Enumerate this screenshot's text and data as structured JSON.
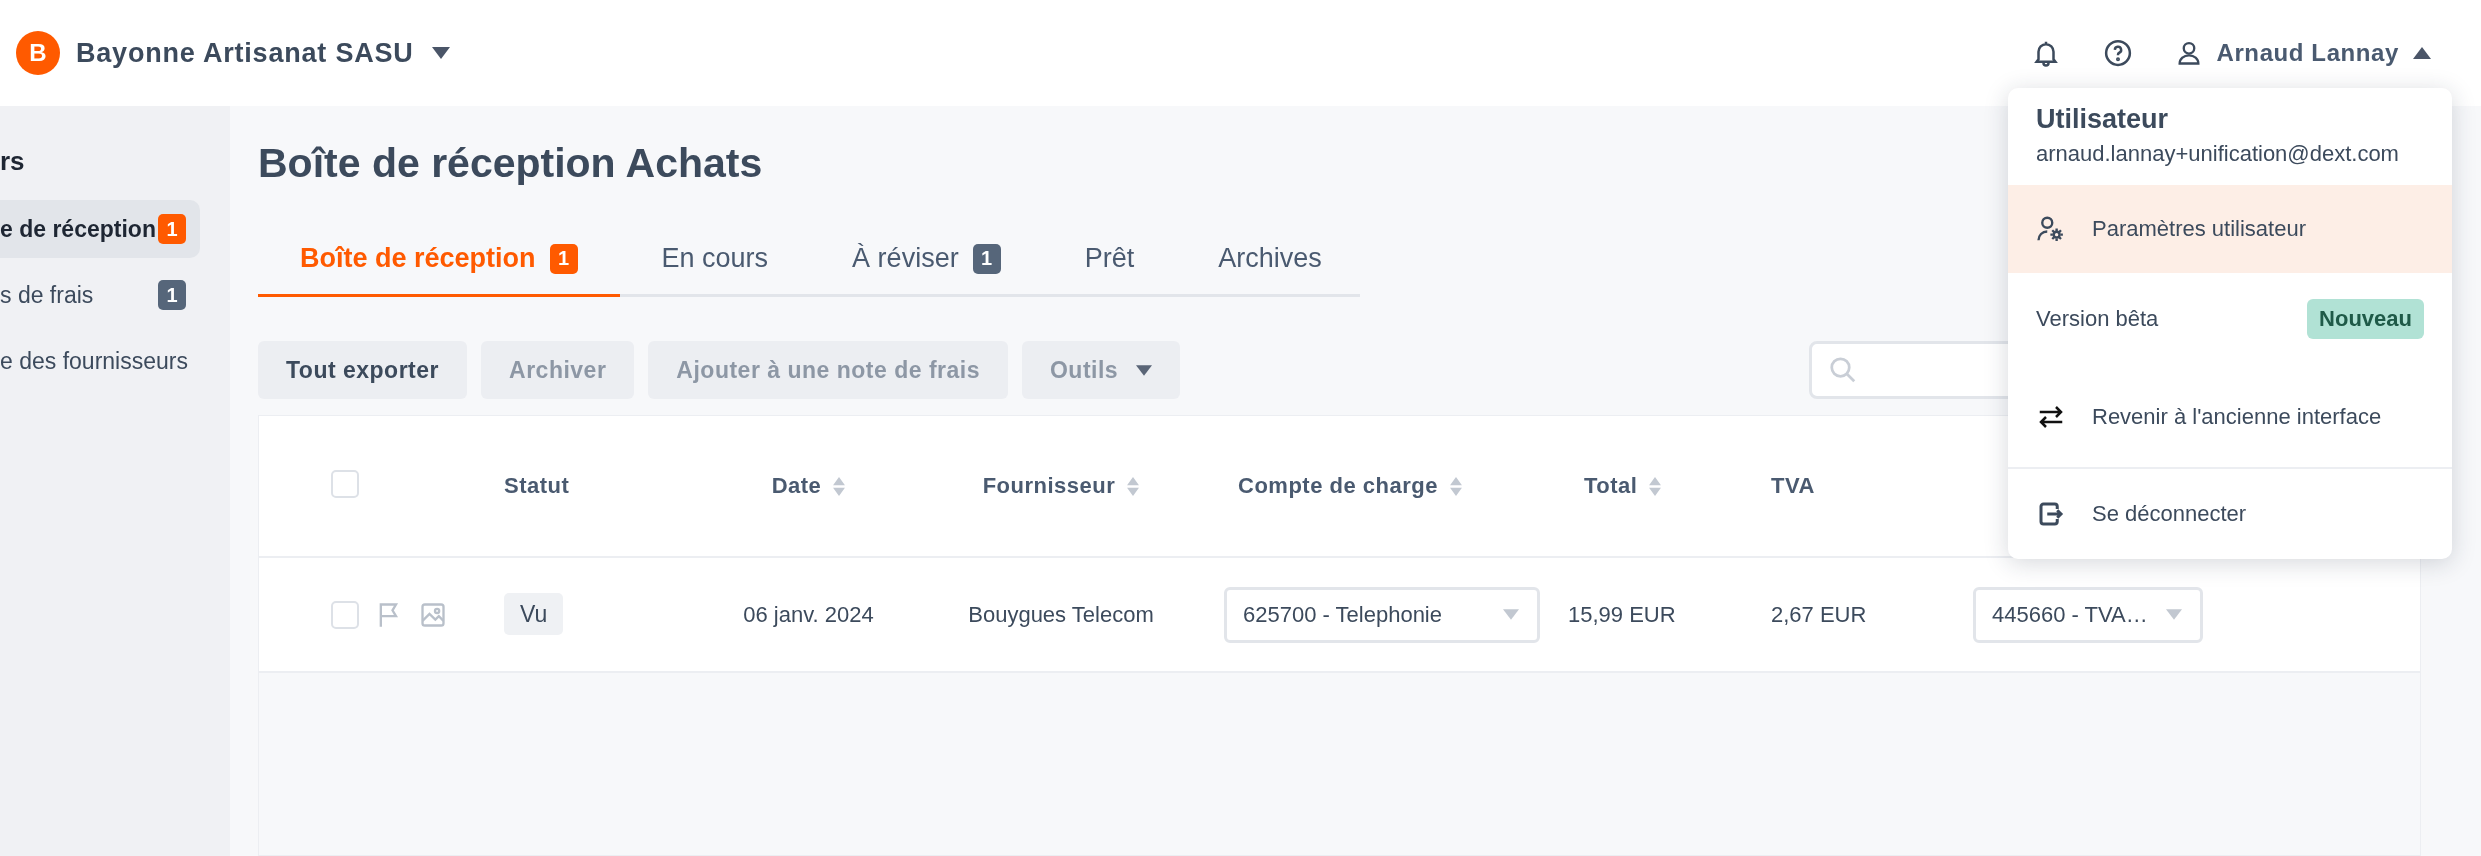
{
  "company": {
    "initial": "B",
    "name": "Bayonne Artisanat SASU"
  },
  "user": {
    "name": "Arnaud Lannay",
    "menu_expanded": true
  },
  "sidebar": {
    "heading": "rs",
    "items": [
      {
        "label": "e de réception",
        "selected": true,
        "badge": {
          "text": "1",
          "color": "#ff5a00"
        }
      },
      {
        "label": "s de frais",
        "selected": false,
        "badge": {
          "text": "1",
          "color": "#56667a"
        }
      },
      {
        "label": "e des fournisseurs",
        "selected": false
      }
    ]
  },
  "page_title": "Boîte de réception Achats",
  "tabs": [
    {
      "label": "Boîte de réception",
      "selected": true,
      "badge": {
        "text": "1",
        "color": "#ff5a00"
      }
    },
    {
      "label": "En cours",
      "selected": false
    },
    {
      "label": "À réviser",
      "selected": false,
      "badge": {
        "text": "1",
        "color": "#56667a"
      }
    },
    {
      "label": "Prêt",
      "selected": false
    },
    {
      "label": "Archives",
      "selected": false
    }
  ],
  "toolbar": [
    {
      "kind": "button",
      "label": "Tout exporter",
      "disabled": false
    },
    {
      "kind": "button",
      "label": "Archiver",
      "disabled": true
    },
    {
      "kind": "button",
      "label": "Ajouter à une note de frais",
      "disabled": true
    },
    {
      "kind": "dropdown",
      "label": "Outils",
      "disabled": true
    }
  ],
  "table": {
    "select_all_checked": false,
    "columns": [
      {
        "label": "Statut",
        "sortable": false
      },
      {
        "label": "Date",
        "sortable": true
      },
      {
        "label": "Fournisseur",
        "sortable": true
      },
      {
        "label": "Compte de charge",
        "sortable": true
      },
      {
        "label": "Total",
        "sortable": true
      },
      {
        "label": "TVA",
        "sortable": false
      }
    ],
    "rows": [
      {
        "checked": false,
        "status": "Vu",
        "date": "06 janv. 2024",
        "supplier": "Bouygues Telecom",
        "account": "625700 - Telephonie",
        "total": "15,99 EUR",
        "tva": "2,67 EUR",
        "tva_account": "445660 - TVA…"
      }
    ]
  },
  "user_menu": {
    "title": "Utilisateur",
    "email": "arnaud.lannay+unification@dext.com",
    "items": [
      {
        "kind": "settings",
        "label": "Paramètres utilisateur",
        "hovered": true
      },
      {
        "kind": "beta",
        "label": "Version bêta",
        "badge": "Nouveau",
        "hovered": false
      },
      {
        "kind": "switch",
        "label": "Revenir à l'ancienne interface",
        "hovered": false
      },
      {
        "kind": "logout",
        "label": "Se déconnecter",
        "hovered": false
      }
    ]
  }
}
